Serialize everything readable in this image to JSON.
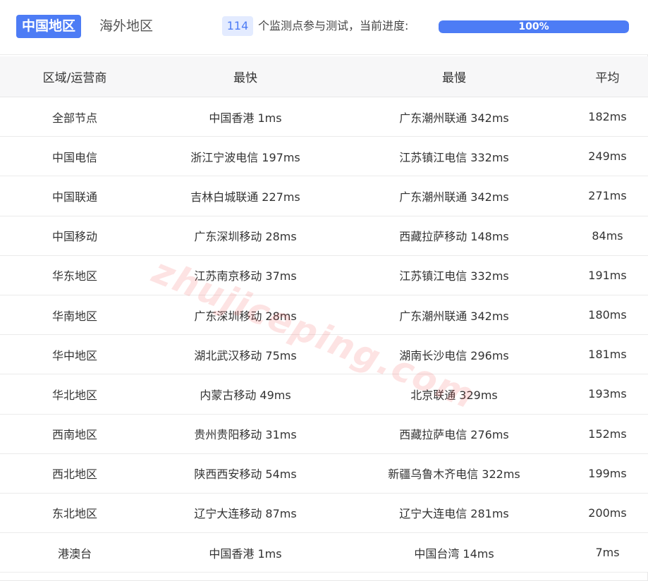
{
  "tabs": {
    "domestic": "中国地区",
    "overseas": "海外地区"
  },
  "progress": {
    "node_count": "114",
    "text": "个监测点参与测试，当前进度:",
    "percent_label": "100%",
    "value": 1.0
  },
  "table": {
    "headers": [
      "区域/运营商",
      "最快",
      "最慢",
      "平均"
    ],
    "rows": [
      [
        "全部节点",
        "中国香港 1ms",
        "广东潮州联通 342ms",
        "182ms"
      ],
      [
        "中国电信",
        "浙江宁波电信 197ms",
        "江苏镇江电信 332ms",
        "249ms"
      ],
      [
        "中国联通",
        "吉林白城联通 227ms",
        "广东潮州联通 342ms",
        "271ms"
      ],
      [
        "中国移动",
        "广东深圳移动 28ms",
        "西藏拉萨移动 148ms",
        "84ms"
      ],
      [
        "华东地区",
        "江苏南京移动 37ms",
        "江苏镇江电信 332ms",
        "191ms"
      ],
      [
        "华南地区",
        "广东深圳移动 28ms",
        "广东潮州联通 342ms",
        "180ms"
      ],
      [
        "华中地区",
        "湖北武汉移动 75ms",
        "湖南长沙电信 296ms",
        "181ms"
      ],
      [
        "华北地区",
        "内蒙古移动 49ms",
        "北京联通 329ms",
        "193ms"
      ],
      [
        "西南地区",
        "贵州贵阳移动 31ms",
        "西藏拉萨电信 276ms",
        "152ms"
      ],
      [
        "西北地区",
        "陕西西安移动 54ms",
        "新疆乌鲁木齐电信 322ms",
        "199ms"
      ],
      [
        "东北地区",
        "辽宁大连移动 87ms",
        "辽宁大连电信 281ms",
        "200ms"
      ],
      [
        "港澳台",
        "中国香港 1ms",
        "中国台湾 14ms",
        "7ms"
      ]
    ]
  },
  "watermark": "zhujiceping.com",
  "colors": {
    "accent": "#4d7cf5",
    "badge_bg": "#e3ebff",
    "header_bg": "#f7f7f8"
  }
}
